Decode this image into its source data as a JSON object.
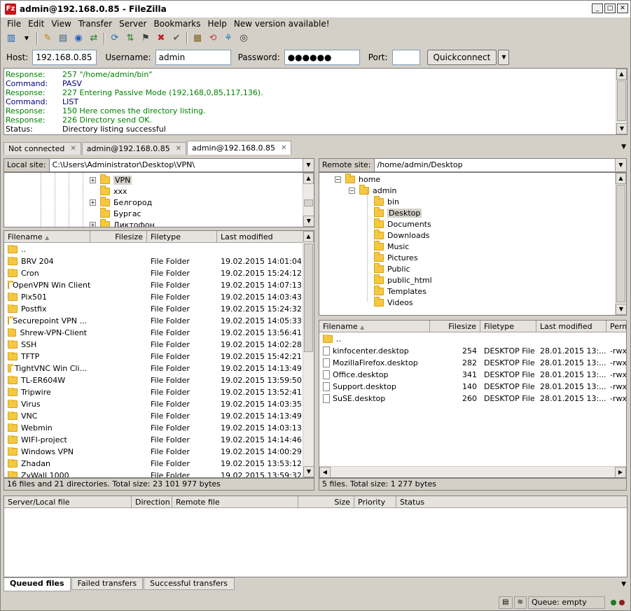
{
  "window": {
    "title": "admin@192.168.0.85 - FileZilla"
  },
  "menu": [
    "File",
    "Edit",
    "View",
    "Transfer",
    "Server",
    "Bookmarks",
    "Help",
    "New version available!"
  ],
  "quickconnect": {
    "host_label": "Host:",
    "host": "192.168.0.85",
    "username_label": "Username:",
    "username": "admin",
    "password_label": "Password:",
    "password": "●●●●●●",
    "port_label": "Port:",
    "port": "",
    "button": "Quickconnect"
  },
  "log": [
    {
      "k": "Response:",
      "v": "257 \"/home/admin/bin\"",
      "c": "#008000"
    },
    {
      "k": "Command:",
      "v": "PASV",
      "c": "#000080"
    },
    {
      "k": "Response:",
      "v": "227 Entering Passive Mode (192,168,0,85,117,136).",
      "c": "#008000"
    },
    {
      "k": "Command:",
      "v": "LIST",
      "c": "#000080"
    },
    {
      "k": "Response:",
      "v": "150 Here comes the directory listing.",
      "c": "#008000"
    },
    {
      "k": "Response:",
      "v": "226 Directory send OK.",
      "c": "#008000"
    },
    {
      "k": "Status:",
      "v": "Directory listing successful",
      "c": "#000000"
    }
  ],
  "tabs": [
    {
      "label": "Not connected"
    },
    {
      "label": "admin@192.168.0.85"
    },
    {
      "label": "admin@192.168.0.85"
    }
  ],
  "local": {
    "site_label": "Local site:",
    "path": "C:\\Users\\Administrator\\Desktop\\VPN\\",
    "tree": [
      {
        "label": "VPN",
        "expander": "+",
        "selected": true
      },
      {
        "label": "xxx",
        "expander": "",
        "selected": false
      },
      {
        "label": "Белгород",
        "expander": "+",
        "selected": false
      },
      {
        "label": "Бургас",
        "expander": "",
        "selected": false
      },
      {
        "label": "Диктофон",
        "expander": "+",
        "selected": false
      }
    ],
    "columns": [
      "Filename",
      "Filesize",
      "Filetype",
      "Last modified"
    ],
    "rows": [
      {
        "name": "..",
        "size": "",
        "type": "",
        "modified": ""
      },
      {
        "name": "BRV 204",
        "size": "",
        "type": "File Folder",
        "modified": "19.02.2015 14:01:04"
      },
      {
        "name": "Cron",
        "size": "",
        "type": "File Folder",
        "modified": "19.02.2015 15:24:12"
      },
      {
        "name": "OpenVPN Win Client",
        "size": "",
        "type": "File Folder",
        "modified": "19.02.2015 14:07:13"
      },
      {
        "name": "Pix501",
        "size": "",
        "type": "File Folder",
        "modified": "19.02.2015 14:03:43"
      },
      {
        "name": "Postfix",
        "size": "",
        "type": "File Folder",
        "modified": "19.02.2015 15:24:32"
      },
      {
        "name": "Securepoint VPN ...",
        "size": "",
        "type": "File Folder",
        "modified": "19.02.2015 14:05:33"
      },
      {
        "name": "Shrew-VPN-Client",
        "size": "",
        "type": "File Folder",
        "modified": "19.02.2015 13:56:41"
      },
      {
        "name": "SSH",
        "size": "",
        "type": "File Folder",
        "modified": "19.02.2015 14:02:28"
      },
      {
        "name": "TFTP",
        "size": "",
        "type": "File Folder",
        "modified": "19.02.2015 15:42:21"
      },
      {
        "name": "TightVNC Win Cli...",
        "size": "",
        "type": "File Folder",
        "modified": "19.02.2015 14:13:49"
      },
      {
        "name": "TL-ER604W",
        "size": "",
        "type": "File Folder",
        "modified": "19.02.2015 13:59:50"
      },
      {
        "name": "Tripwire",
        "size": "",
        "type": "File Folder",
        "modified": "19.02.2015 13:52:41"
      },
      {
        "name": "Virus",
        "size": "",
        "type": "File Folder",
        "modified": "19.02.2015 14:03:35"
      },
      {
        "name": "VNC",
        "size": "",
        "type": "File Folder",
        "modified": "19.02.2015 14:13:49"
      },
      {
        "name": "Webmin",
        "size": "",
        "type": "File Folder",
        "modified": "19.02.2015 14:03:13"
      },
      {
        "name": "WIFI-project",
        "size": "",
        "type": "File Folder",
        "modified": "19.02.2015 14:14:46"
      },
      {
        "name": "Windows VPN",
        "size": "",
        "type": "File Folder",
        "modified": "19.02.2015 14:00:29"
      },
      {
        "name": "Zhadan",
        "size": "",
        "type": "File Folder",
        "modified": "19.02.2015 13:53:12"
      },
      {
        "name": "ZyWall 1000",
        "size": "",
        "type": "File Folder",
        "modified": "19.02.2015 13:59:32"
      }
    ],
    "status": "16 files and 21 directories. Total size: 23 101 977 bytes"
  },
  "remote": {
    "site_label": "Remote site:",
    "path": "/home/admin/Desktop",
    "tree": [
      {
        "label": "home",
        "expander": "−",
        "selected": false
      },
      {
        "label": "admin",
        "expander": "−",
        "selected": false
      },
      {
        "label": "bin",
        "expander": "",
        "selected": false
      },
      {
        "label": "Desktop",
        "expander": "",
        "selected": true
      },
      {
        "label": "Documents",
        "expander": "",
        "selected": false
      },
      {
        "label": "Downloads",
        "expander": "",
        "selected": false
      },
      {
        "label": "Music",
        "expander": "",
        "selected": false
      },
      {
        "label": "Pictures",
        "expander": "",
        "selected": false
      },
      {
        "label": "Public",
        "expander": "",
        "selected": false
      },
      {
        "label": "public_html",
        "expander": "",
        "selected": false
      },
      {
        "label": "Templates",
        "expander": "",
        "selected": false
      },
      {
        "label": "Videos",
        "expander": "",
        "selected": false
      }
    ],
    "columns": [
      "Filename",
      "Filesize",
      "Filetype",
      "Last modified",
      "Perm"
    ],
    "rows": [
      {
        "name": "..",
        "size": "",
        "type": "",
        "modified": "",
        "perm": "",
        "folder": true
      },
      {
        "name": "kinfocenter.desktop",
        "size": "254",
        "type": "DESKTOP File",
        "modified": "28.01.2015 13:...",
        "perm": "-rwx",
        "folder": false
      },
      {
        "name": "MozillaFirefox.desktop",
        "size": "282",
        "type": "DESKTOP File",
        "modified": "28.01.2015 13:...",
        "perm": "-rwx",
        "folder": false
      },
      {
        "name": "Office.desktop",
        "size": "341",
        "type": "DESKTOP File",
        "modified": "28.01.2015 13:...",
        "perm": "-rwx",
        "folder": false
      },
      {
        "name": "Support.desktop",
        "size": "140",
        "type": "DESKTOP File",
        "modified": "28.01.2015 13:...",
        "perm": "-rwx",
        "folder": false
      },
      {
        "name": "SuSE.desktop",
        "size": "260",
        "type": "DESKTOP File",
        "modified": "28.01.2015 13:...",
        "perm": "-rwx",
        "folder": false
      }
    ],
    "status": "5 files. Total size: 1 277 bytes"
  },
  "queue": {
    "columns": [
      "Server/Local file",
      "Direction",
      "Remote file",
      "Size",
      "Priority",
      "Status"
    ],
    "tabs": [
      "Queued files",
      "Failed transfers",
      "Successful transfers"
    ]
  },
  "statusbar": {
    "queue": "Queue: empty"
  }
}
